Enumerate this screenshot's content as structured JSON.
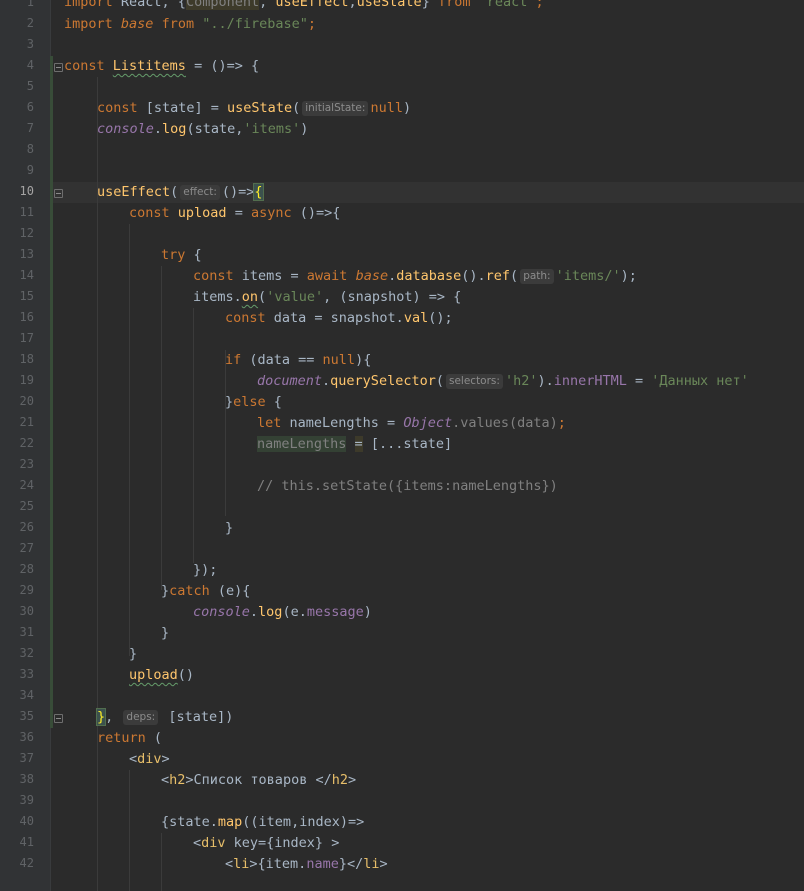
{
  "editor": {
    "active_line": "10",
    "line_numbers": [
      "1",
      "2",
      "3",
      "4",
      "5",
      "6",
      "7",
      "8",
      "9",
      "10",
      "11",
      "12",
      "13",
      "14",
      "15",
      "16",
      "17",
      "18",
      "19",
      "20",
      "21",
      "22",
      "23",
      "24",
      "25",
      "26",
      "27",
      "28",
      "29",
      "30",
      "31",
      "32",
      "33",
      "34",
      "35",
      "36",
      "37",
      "38",
      "39",
      "40",
      "41",
      "42"
    ],
    "colors": {
      "background": "#2b2b2b",
      "gutter": "#313335",
      "keyword": "#cc7832",
      "string": "#6a8759",
      "function": "#ffc66d",
      "field": "#9876aa",
      "comment": "#808080",
      "tag": "#e8bf6a",
      "text": "#a9b7c6"
    }
  },
  "code": {
    "l1": [
      "import",
      " React, {",
      "Component",
      ", ",
      "useEffect",
      ",",
      "useState",
      "} ",
      "from",
      " ",
      "'react'",
      ";"
    ],
    "l2": [
      "import",
      " ",
      "base",
      " ",
      "from",
      " ",
      "\"../firebase\"",
      ";"
    ],
    "l4": [
      "const",
      " ",
      "Listitems",
      " = ()=> {"
    ],
    "l6": [
      "const",
      " [state] = ",
      "useState",
      "(",
      "initialState:",
      "null",
      ")"
    ],
    "l7": [
      "console",
      ".",
      "log",
      "(state,",
      "'items'",
      ")"
    ],
    "l10": [
      "useEffect",
      "(",
      "effect:",
      "()=>",
      "{"
    ],
    "l11": [
      "const",
      " ",
      "upload",
      " = ",
      "async",
      " ()=>{"
    ],
    "l13": [
      "try",
      " {"
    ],
    "l14": [
      "const",
      " items = ",
      "await",
      " ",
      "base",
      ".",
      "database",
      "().",
      "ref",
      "(",
      "path:",
      "'items/'",
      ");"
    ],
    "l15": [
      "items.",
      "on",
      "(",
      "'value'",
      ", (snapshot) => {"
    ],
    "l16": [
      "const",
      " data = snapshot.",
      "val",
      "();"
    ],
    "l18": [
      "if",
      " (data == ",
      "null",
      "){"
    ],
    "l19": [
      "document",
      ".",
      "querySelector",
      "(",
      "selectors:",
      "'h2'",
      ").",
      "innerHTML",
      " = ",
      "'Данных нет'"
    ],
    "l20": [
      "}",
      "else",
      " {"
    ],
    "l21": [
      "let",
      " nameLengths = ",
      "Object",
      ".values(data)",
      ";"
    ],
    "l22": [
      "nameLengths",
      " ",
      "=",
      " [...state]"
    ],
    "l24": [
      "// this.setState({items:nameLengths})"
    ],
    "l26": [
      "}"
    ],
    "l28": [
      "});"
    ],
    "l29": [
      "}",
      "catch",
      " (e){"
    ],
    "l30": [
      "console",
      ".",
      "log",
      "(e.",
      "message",
      ")"
    ],
    "l31": [
      "}"
    ],
    "l32": [
      "}"
    ],
    "l33": [
      "upload",
      "()"
    ],
    "l35": [
      "}",
      ", ",
      "deps:",
      " [state])"
    ],
    "l36": [
      "return",
      " ("
    ],
    "l37": [
      "<",
      "div",
      ">"
    ],
    "l38": [
      "<",
      "h2",
      ">Список товаров </",
      "h2",
      ">"
    ],
    "l40": [
      "{state.",
      "map",
      "((item,index)=>"
    ],
    "l41": [
      "<",
      "div",
      " key={index} >"
    ],
    "l42": [
      "<",
      "li",
      ">{item.",
      "name",
      "}</",
      "li",
      ">"
    ]
  }
}
